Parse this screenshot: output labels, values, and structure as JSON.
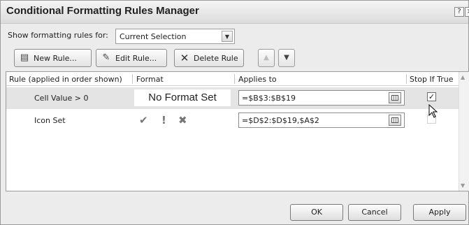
{
  "window": {
    "title": "Conditional Formatting Rules Manager",
    "help_glyph": "?",
    "close_glyph": "×"
  },
  "scope": {
    "label": "Show formatting rules for:",
    "selected": "Current Selection"
  },
  "toolbar": {
    "new_rule": "New Rule...",
    "edit_rule": "Edit Rule...",
    "delete_rule": "Delete Rule",
    "move_up_glyph": "▲",
    "move_down_glyph": "▼"
  },
  "columns": {
    "rule": "Rule (applied in order shown)",
    "format": "Format",
    "applies_to": "Applies to",
    "stop_if_true": "Stop If True"
  },
  "rules": [
    {
      "name": "Cell Value > 0",
      "format_preview": "No Format Set",
      "applies_to": "=$B$3:$B$19",
      "stop_if_true": true,
      "selected": true
    },
    {
      "name": "Icon Set",
      "format_icons": [
        "✔",
        "!",
        "✖"
      ],
      "applies_to": "=$D$2:$D$19,$A$2",
      "stop_if_true": false,
      "selected": false
    }
  ],
  "footer": {
    "ok": "OK",
    "cancel": "Cancel",
    "apply": "Apply"
  },
  "icons": {
    "new_rule": "new-rule-icon",
    "edit_rule": "edit-rule-icon",
    "delete_rule": "delete-x-icon",
    "range_picker": "range-picker-icon"
  }
}
